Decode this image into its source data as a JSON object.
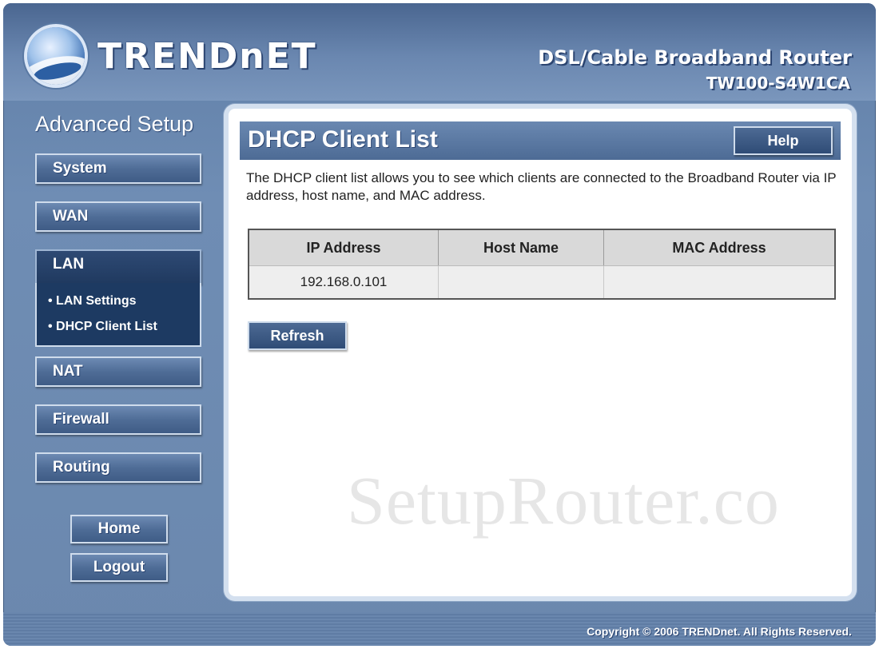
{
  "brand": {
    "logo_text": "TRENDnET",
    "product_title": "DSL/Cable Broadband Router",
    "model": "TW100-S4W1CA"
  },
  "sidebar": {
    "title": "Advanced Setup",
    "items": [
      {
        "label": "System"
      },
      {
        "label": "WAN"
      },
      {
        "label": "LAN",
        "active": true
      },
      {
        "label": "NAT"
      },
      {
        "label": "Firewall"
      },
      {
        "label": "Routing"
      }
    ],
    "lan_submenu": [
      {
        "label": "• LAN Settings"
      },
      {
        "label": "• DHCP Client List"
      }
    ],
    "home_label": "Home",
    "logout_label": "Logout"
  },
  "main": {
    "title": "DHCP Client List",
    "help_label": "Help",
    "description": "The DHCP client list allows you to see which clients are connected to the Broadband Router via IP address, host name, and MAC address.",
    "table": {
      "headers": [
        "IP Address",
        "Host Name",
        "MAC Address"
      ],
      "rows": [
        [
          "192.168.0.101",
          "",
          ""
        ]
      ]
    },
    "refresh_label": "Refresh"
  },
  "watermark": "SetupRouter.co",
  "footer": {
    "copyright": "Copyright © 2006 TRENDnet. All Rights Reserved."
  }
}
